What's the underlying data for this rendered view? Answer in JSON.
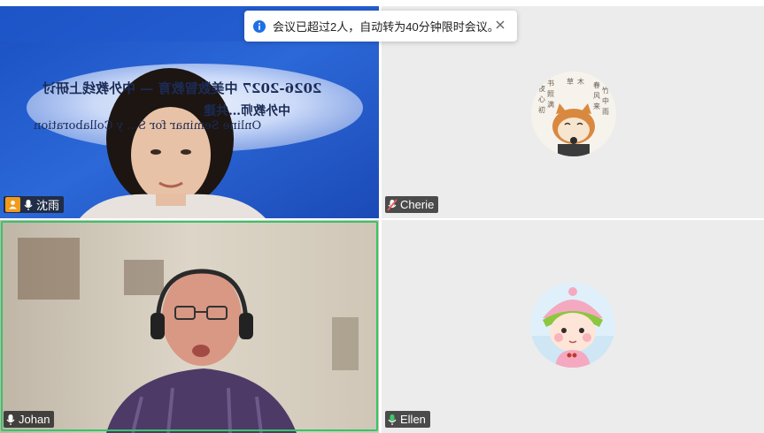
{
  "toast": {
    "message": "会议已超过2人，自动转为40分钟限时会议。",
    "close_icon": "close-icon",
    "info_icon": "info-icon"
  },
  "participants": [
    {
      "name": "沈雨",
      "mic": "mic-on",
      "host": true
    },
    {
      "name": "Cherie",
      "mic": "mic-muted",
      "host": false
    },
    {
      "name": "Johan",
      "mic": "mic-on",
      "host": false,
      "active_speaker": true
    },
    {
      "name": "Ellen",
      "mic": "mic-speaking",
      "host": false
    }
  ],
  "background_banner": {
    "line1": "2026-2027 中美数智教育 — 中外教线上研讨",
    "line2": "中外教师…共建",
    "line3": "Online Seminar for S… y Collaboration"
  },
  "colors": {
    "active_border": "#34c56a",
    "host_badge": "#f19a1b",
    "speaking_mic": "#3fc96f",
    "muted_mic": "#f05a4f",
    "info": "#1f6fe5"
  }
}
